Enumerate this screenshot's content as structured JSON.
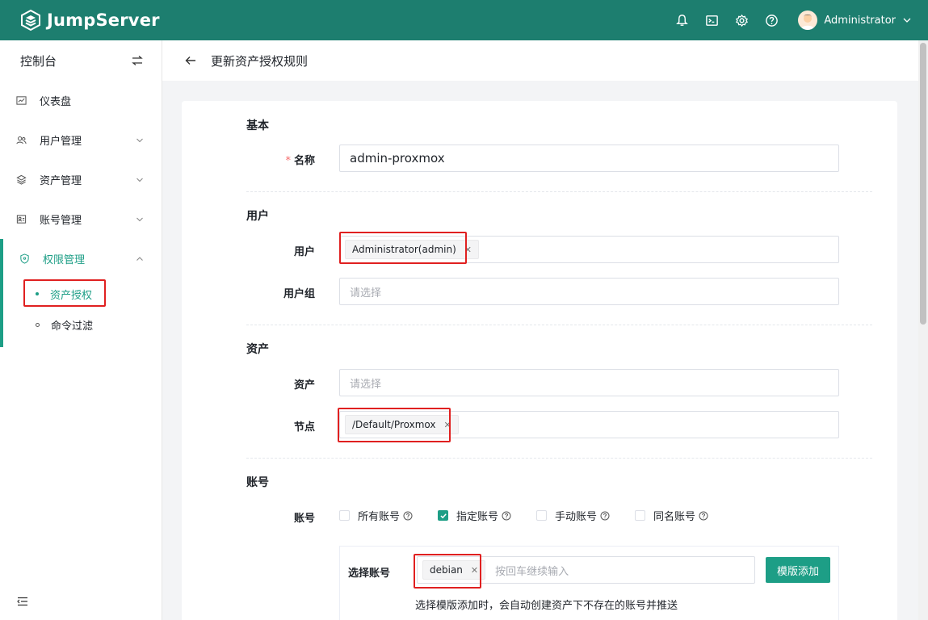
{
  "header": {
    "brand": "JumpServer",
    "user_name": "Administrator"
  },
  "sidebar": {
    "title": "控制台",
    "items": [
      {
        "label": "仪表盘",
        "icon": "dashboard-icon"
      },
      {
        "label": "用户管理",
        "icon": "users-icon"
      },
      {
        "label": "资产管理",
        "icon": "layers-icon"
      },
      {
        "label": "账号管理",
        "icon": "account-icon"
      },
      {
        "label": "权限管理",
        "icon": "shield-icon"
      }
    ],
    "sub_items": [
      {
        "label": "资产授权",
        "active": true
      },
      {
        "label": "命令过滤",
        "active": false
      }
    ]
  },
  "page": {
    "title": "更新资产授权规则"
  },
  "form": {
    "sections": {
      "basic": "基本",
      "user": "用户",
      "asset": "资产",
      "account": "账号"
    },
    "name_label": "名称",
    "name_value": "admin-proxmox",
    "user_label": "用户",
    "user_tag": "Administrator(admin)",
    "usergroup_label": "用户组",
    "usergroup_placeholder": "请选择",
    "asset_label": "资产",
    "asset_placeholder": "请选择",
    "node_label": "节点",
    "node_tag": "/Default/Proxmox",
    "account_label": "账号",
    "account_options": [
      {
        "label": "所有账号",
        "checked": false
      },
      {
        "label": "指定账号",
        "checked": true
      },
      {
        "label": "手动账号",
        "checked": false
      },
      {
        "label": "同名账号",
        "checked": false
      }
    ],
    "select_account_label": "选择账号",
    "account_tag": "debian",
    "account_input_placeholder": "按回车继续输入",
    "template_button": "模版添加",
    "hint": "选择模版添加时，会自动创建资产下不存在的账号并推送"
  },
  "colors": {
    "brand": "#1d7e6f",
    "accent": "#1d9e86",
    "highlight": "#e02020"
  }
}
